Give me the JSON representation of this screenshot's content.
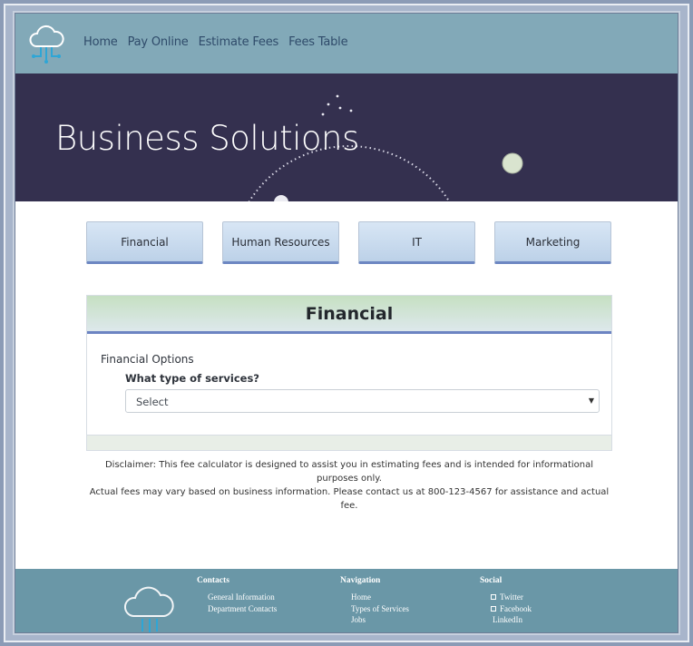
{
  "header": {
    "nav": [
      "Home",
      "Pay Online",
      "Estimate Fees",
      "Fees Table"
    ]
  },
  "hero": {
    "title": "Business Solutions"
  },
  "tabs": [
    "Financial",
    "Human Resources",
    "IT",
    "Marketing"
  ],
  "panel": {
    "title": "Financial",
    "subtitle": "Financial Options",
    "question": "What type of services?",
    "select_value": "Select"
  },
  "disclaimer": {
    "line1": "Disclaimer: This fee calculator is designed to assist you in estimating fees and is intended for informational purposes only.",
    "line2": "Actual fees may vary based on business information. Please contact us at 800-123-4567 for assistance and actual fee."
  },
  "footer": {
    "contacts": {
      "heading": "Contacts",
      "items": [
        "General Information",
        "Department Contacts"
      ]
    },
    "navigation": {
      "heading": "Navigation",
      "items": [
        "Home",
        "Types of Services",
        "Jobs"
      ]
    },
    "social": {
      "heading": "Social",
      "items": [
        "Twitter",
        "Facebook",
        "LinkedIn"
      ]
    }
  },
  "colors": {
    "header_bg": "#82a9b8",
    "hero_bg": "#34304f",
    "footer_bg": "#6a97a7",
    "tab_accent": "#6d87c2"
  },
  "icons": {
    "logo": "cloud-network-icon",
    "footer_logo": "cloud-network-icon",
    "select_caret": "caret-down-icon",
    "social_box": "checkbox-icon"
  }
}
